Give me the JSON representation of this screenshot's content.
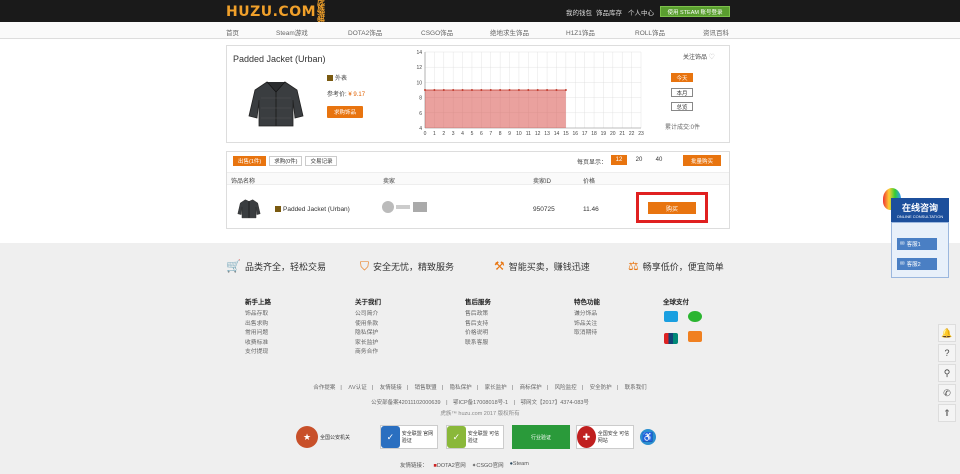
{
  "header": {
    "logo": "HUZU.COM",
    "logo_sub": "虎族游戏",
    "links": [
      "我的钱包",
      "饰品库存",
      "个人中心"
    ],
    "steam_login": "使用 STEAM 账号登录"
  },
  "nav": [
    "首页",
    "Steam游戏",
    "DOTA2饰品",
    "CSGO饰品",
    "绝地求生饰品",
    "H1Z1饰品",
    "ROLL饰品",
    "资讯百科"
  ],
  "item": {
    "name": "Padded Jacket (Urban)",
    "appearance_label": "外表",
    "ref_price_label": "参考价:",
    "ref_price": "¥ 9.17",
    "buy_button": "求购饰品"
  },
  "chart_data": {
    "type": "area",
    "x": [
      0,
      1,
      2,
      3,
      4,
      5,
      6,
      7,
      8,
      9,
      10,
      11,
      12,
      13,
      14,
      15
    ],
    "values": [
      9,
      9,
      9,
      9,
      9,
      9,
      9,
      9,
      9,
      9,
      9,
      9,
      9,
      9,
      9,
      9
    ],
    "xticks": [
      0,
      1,
      2,
      3,
      4,
      5,
      6,
      7,
      8,
      9,
      10,
      11,
      12,
      13,
      14,
      15,
      16,
      17,
      18,
      19,
      20,
      21,
      22,
      23
    ],
    "yticks": [
      4,
      6,
      8,
      10,
      12,
      14
    ],
    "xlim": [
      0,
      23
    ],
    "ylim": [
      4,
      14
    ],
    "grid": true,
    "color": "#d9534f"
  },
  "range": {
    "follow": "关注饰品",
    "buttons": [
      "今天",
      "本月",
      "总览"
    ],
    "total_sold": "累计成交:0件"
  },
  "listing": {
    "tabs": [
      "出售(1件)",
      "求购(0件)",
      "交易记录"
    ],
    "per_page_label": "每页显示：",
    "per_page": [
      "12",
      "20",
      "40"
    ],
    "bulk_buy": "批量购买",
    "columns": [
      "饰品名称",
      "卖家",
      "卖家ID",
      "价格"
    ],
    "rows": [
      {
        "name": "Padded Jacket (Urban)",
        "seller_id": "950725",
        "price": "11.46",
        "action": "购买"
      }
    ]
  },
  "features": [
    "品类齐全，轻松交易",
    "安全无忧，精致服务",
    "智能买卖，赚钱迅速",
    "畅享低价，便宜简单"
  ],
  "footer_cols": [
    {
      "title": "新手上路",
      "links": [
        "饰品存取",
        "出售求购",
        "常用问题",
        "收费标准",
        "支付提现"
      ]
    },
    {
      "title": "关于我们",
      "links": [
        "公司简介",
        "使用条款",
        "隐私保护",
        "家长监护",
        "商务合作"
      ]
    },
    {
      "title": "售后服务",
      "links": [
        "售后政策",
        "售后支持",
        "价格说明",
        "联系客服"
      ]
    },
    {
      "title": "特色功能",
      "links": [
        "谦分饰品",
        "饰品关注",
        "取消期待"
      ]
    },
    {
      "title": "全球支付",
      "links": []
    }
  ],
  "footer_links": [
    "合作提案",
    "ΛV认证",
    "友情链接",
    "销售联盟",
    "隐私保护",
    "家长监护",
    "商标保护",
    "风险监控",
    "安全防护",
    "联系我们"
  ],
  "icp": "公安部备案42011102000639　|　鄂ICP备17008018号-1　|　鄂网文【2017】4374-083号",
  "copyright": "虎族™ huzu.com 2017 版权所有",
  "badges": [
    "全国公安机关",
    "安全联盟 官网验证",
    "安全联盟 可信验证",
    "行业验证",
    "全国安全 可信网站"
  ],
  "friends_label": "友情链接：",
  "friends": [
    "DOTA2官网",
    "CSGO官网",
    "Steam"
  ],
  "online": {
    "title": "在线咨询",
    "sub": "ONLINE CONSULTATION",
    "qq1": "客服1",
    "qq2": "客服2"
  }
}
